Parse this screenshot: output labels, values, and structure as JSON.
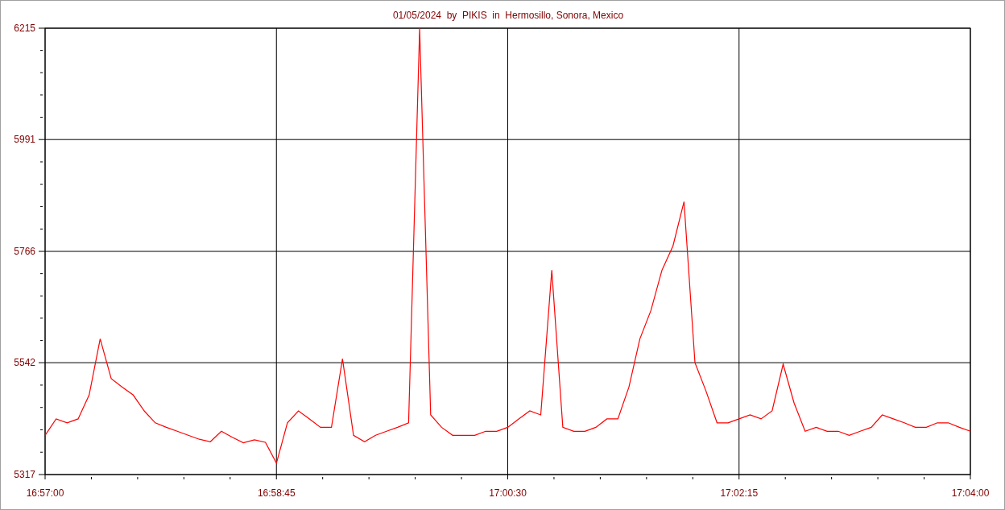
{
  "chart_data": {
    "type": "line",
    "title": "01/05/2024  by  PIKIS  in  Hermosillo, Sonora, Mexico",
    "categories": [
      "16:57:00",
      null,
      null,
      null,
      null,
      null,
      null,
      null,
      null,
      null,
      null,
      null,
      null,
      null,
      null,
      null,
      null,
      null,
      null,
      null,
      null,
      "16:58:45",
      null,
      null,
      null,
      null,
      null,
      null,
      null,
      null,
      null,
      null,
      null,
      null,
      null,
      null,
      null,
      null,
      null,
      null,
      null,
      null,
      "17:00:30",
      null,
      null,
      null,
      null,
      null,
      null,
      null,
      null,
      null,
      null,
      null,
      null,
      null,
      null,
      null,
      null,
      null,
      null,
      null,
      null,
      "17:02:15",
      null,
      null,
      null,
      null,
      null,
      null,
      null,
      null,
      null,
      null,
      null,
      null,
      null,
      null,
      null,
      null,
      null,
      null,
      null,
      null,
      "17:04:00"
    ],
    "series": [
      {
        "color": "#ff0000",
        "values": [
          5396,
          5429,
          5421,
          5429,
          5477,
          5590,
          5510,
          5493,
          5477,
          5445,
          5421,
          5412,
          5404,
          5396,
          5388,
          5383,
          5404,
          5392,
          5381,
          5387,
          5382,
          5340,
          5421,
          5445,
          5429,
          5412,
          5412,
          5550,
          5396,
          5383,
          5396,
          5404,
          5412,
          5421,
          6215,
          5437,
          5412,
          5396,
          5396,
          5396,
          5404,
          5404,
          5412,
          5429,
          5445,
          5437,
          5728,
          5412,
          5404,
          5404,
          5412,
          5429,
          5429,
          5493,
          5590,
          5647,
          5728,
          5777,
          5866,
          5542,
          5485,
          5421,
          5421,
          5429,
          5437,
          5429,
          5445,
          5539,
          5461,
          5404,
          5412,
          5404,
          5404,
          5396,
          5404,
          5412,
          5437,
          5429,
          5421,
          5412,
          5412,
          5421,
          5421,
          5412,
          5404
        ]
      }
    ],
    "ylim": [
      5317,
      6215
    ],
    "yticks": [
      5317,
      5542,
      5766,
      5991,
      6215
    ],
    "grid": true
  }
}
